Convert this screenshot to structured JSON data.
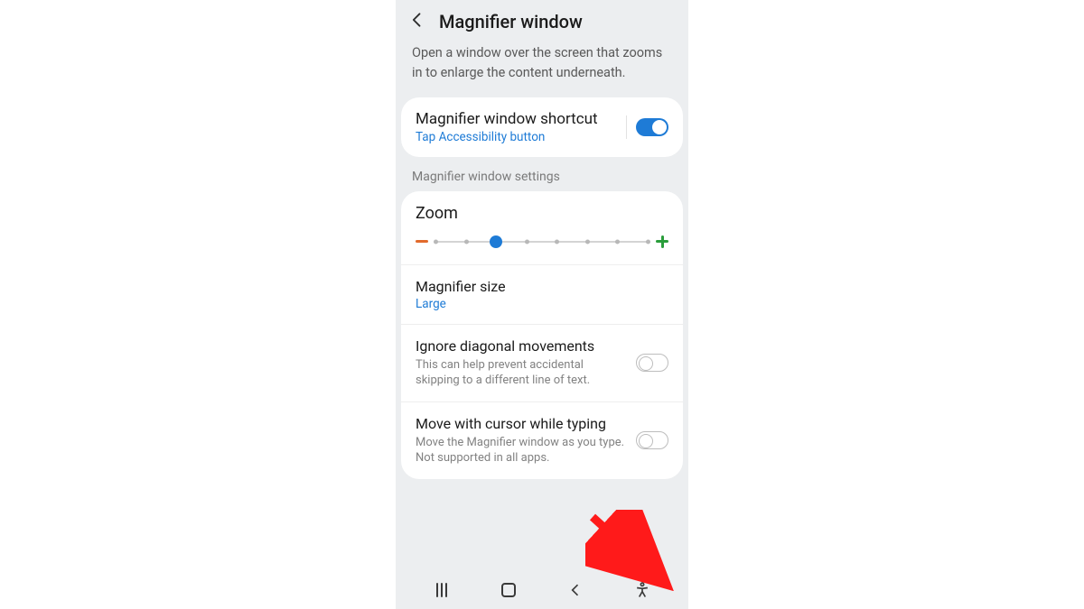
{
  "header": {
    "title": "Magnifier window",
    "intro": "Open a window over the screen that zooms in to enlarge the content underneath."
  },
  "shortcut": {
    "title": "Magnifier window shortcut",
    "subtitle": "Tap Accessibility button",
    "enabled": true
  },
  "section_label": "Magnifier window settings",
  "zoom": {
    "title": "Zoom",
    "steps": 8,
    "current_index": 2
  },
  "magnifier_size": {
    "title": "Magnifier size",
    "value": "Large"
  },
  "ignore_diagonal": {
    "title": "Ignore diagonal movements",
    "subtitle": "This can help prevent accidental skipping to a different line of text.",
    "enabled": false
  },
  "move_cursor": {
    "title": "Move with cursor while typing",
    "subtitle": "Move the Magnifier window as you type. Not supported in all apps.",
    "enabled": false
  },
  "annotation": {
    "arrow_target": "accessibility-nav-button",
    "color": "#ff1a1a"
  }
}
